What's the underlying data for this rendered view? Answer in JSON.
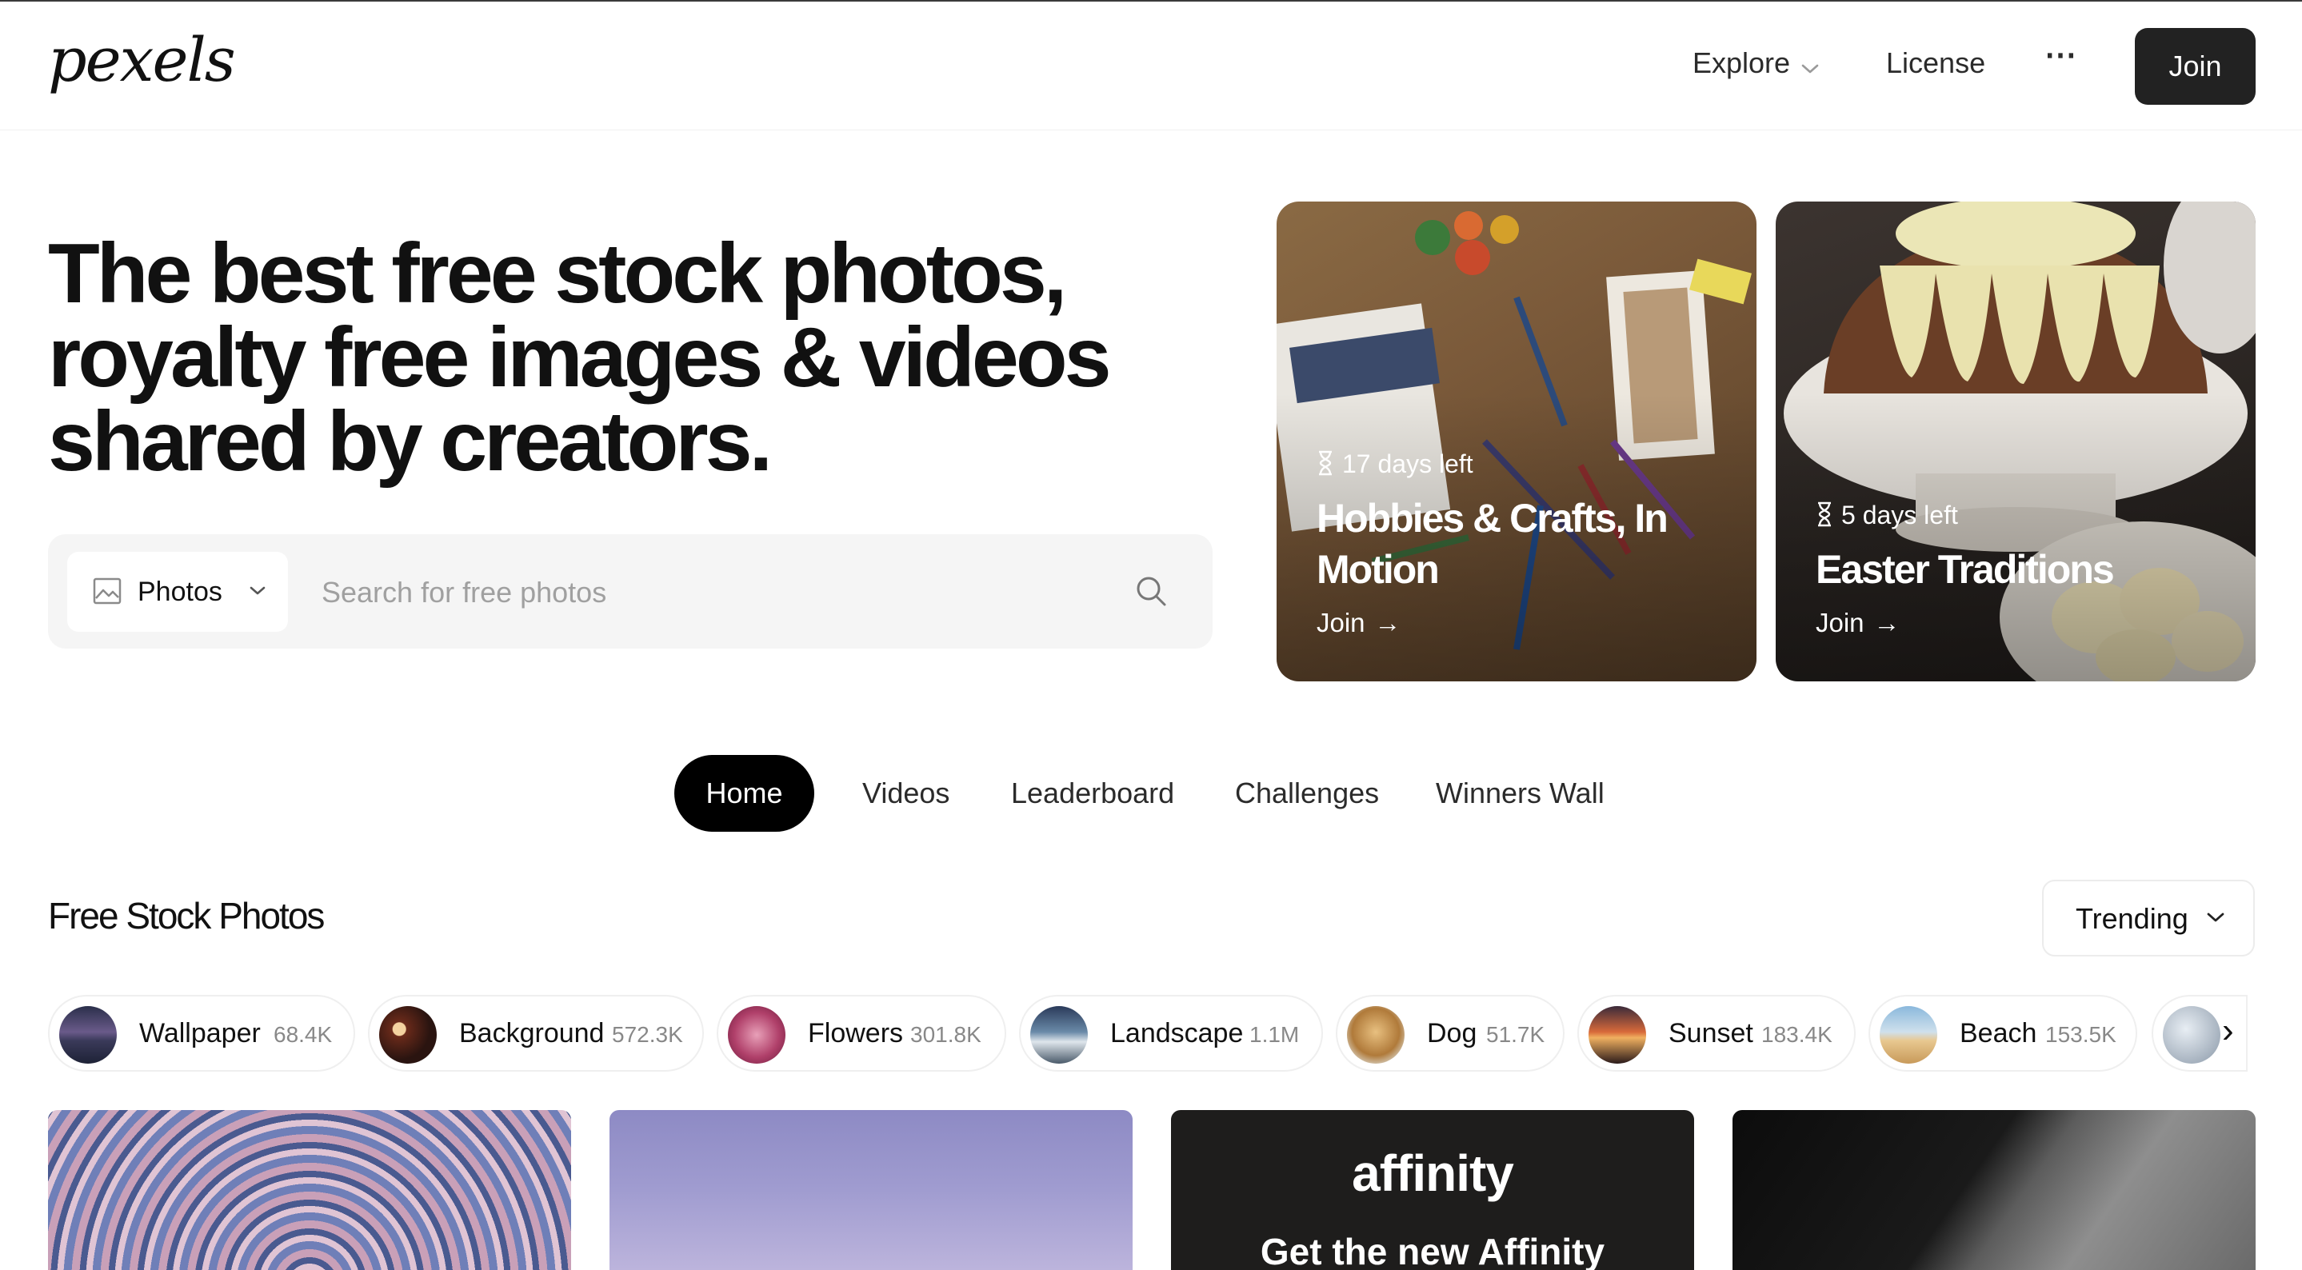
{
  "header": {
    "logo": "pexels",
    "nav": {
      "explore": "Explore",
      "license": "License",
      "more": "⋯"
    },
    "join": "Join"
  },
  "hero": {
    "title": "The best free stock photos, royalty free images & videos shared by creators.",
    "search": {
      "type": "Photos",
      "placeholder": "Search for free photos"
    }
  },
  "challenges": [
    {
      "days_left": "17 days left",
      "title": "Hobbies & Crafts, In Motion",
      "cta": "Join"
    },
    {
      "days_left": "5 days left",
      "title": "Easter Traditions",
      "cta": "Join"
    }
  ],
  "tabs": [
    "Home",
    "Videos",
    "Leaderboard",
    "Challenges",
    "Winners Wall"
  ],
  "active_tab": "Home",
  "section": {
    "title": "Free Stock Photos",
    "sort": "Trending"
  },
  "chips": [
    {
      "name": "Wallpaper",
      "count": "68.4K"
    },
    {
      "name": "Background",
      "count": "572.3K"
    },
    {
      "name": "Flowers",
      "count": "301.8K"
    },
    {
      "name": "Landscape",
      "count": "1.1M"
    },
    {
      "name": "Dog",
      "count": "51.7K"
    },
    {
      "name": "Sunset",
      "count": "183.4K"
    },
    {
      "name": "Beach",
      "count": "153.5K"
    }
  ],
  "ad": {
    "brand": "affinity",
    "headline": "Get the new Affinity"
  },
  "colors": {
    "primary_button": "#222222",
    "active_tab": "#000000",
    "search_bg": "#f5f5f5",
    "muted_text": "#888888"
  }
}
